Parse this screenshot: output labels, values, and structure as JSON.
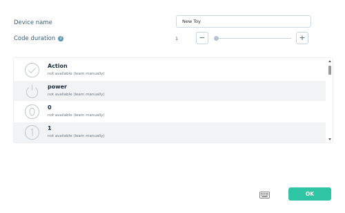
{
  "form": {
    "device_name_label": "Device name",
    "device_name_value": "New Toy",
    "code_duration_label": "Code duration",
    "info_icon": "info-icon",
    "code_duration_value": "1",
    "minus_label": "−",
    "plus_label": "+",
    "slider_level": 0
  },
  "list": {
    "items": [
      {
        "title": "Action",
        "subtitle": "not available (learn manually)",
        "icon": "check-circle-icon"
      },
      {
        "title": "power",
        "subtitle": "not available (learn manually)",
        "icon": "power-icon"
      },
      {
        "title": "0",
        "subtitle": "not available (learn manually)",
        "icon": "digit-zero-icon"
      },
      {
        "title": "1",
        "subtitle": "not available (learn manually)",
        "icon": "digit-one-icon"
      }
    ]
  },
  "footer": {
    "keyboard_icon": "keyboard-icon",
    "ok_label": "OK"
  },
  "colors": {
    "accent": "#2ec4a4",
    "label": "#3a5f7a",
    "info": "#5f98b6",
    "icon_stroke": "#c3c9ce"
  }
}
